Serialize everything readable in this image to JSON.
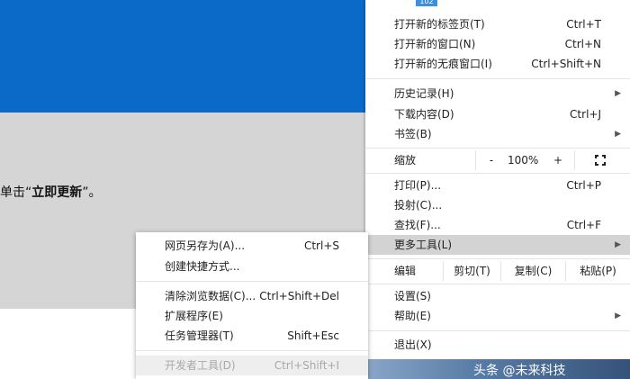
{
  "page": {
    "instruction_prefix": "单击“",
    "instruction_bold": "立即更新",
    "instruction_suffix": "”。"
  },
  "menu": {
    "badge": "102",
    "items": [
      {
        "label": "打开新的标签页(T)",
        "shortcut": "Ctrl+T"
      },
      {
        "label": "打开新的窗口(N)",
        "shortcut": "Ctrl+N"
      },
      {
        "label": "打开新的无痕窗口(I)",
        "shortcut": "Ctrl+Shift+N"
      },
      {
        "label": "历史记录(H)",
        "shortcut": "▶"
      },
      {
        "label": "下载内容(D)",
        "shortcut": "Ctrl+J"
      },
      {
        "label": "书签(B)",
        "shortcut": "▶"
      },
      {
        "label": "打印(P)...",
        "shortcut": "Ctrl+P"
      },
      {
        "label": "投射(C)...",
        "shortcut": ""
      },
      {
        "label": "查找(F)...",
        "shortcut": "Ctrl+F"
      },
      {
        "label": "更多工具(L)",
        "shortcut": "▶"
      },
      {
        "label": "设置(S)",
        "shortcut": ""
      },
      {
        "label": "帮助(E)",
        "shortcut": "▶"
      },
      {
        "label": "退出(X)",
        "shortcut": ""
      }
    ],
    "zoom": {
      "label": "缩放",
      "minus": "-",
      "value": "100%",
      "plus": "+"
    },
    "edit": {
      "label": "编辑",
      "cut": "剪切(T)",
      "copy": "复制(C)",
      "paste": "粘贴(P)"
    },
    "watermark": "头条 @未来科技"
  },
  "submenu": {
    "items": [
      {
        "label": "网页另存为(A)...",
        "shortcut": "Ctrl+S"
      },
      {
        "label": "创建快捷方式...",
        "shortcut": ""
      },
      {
        "label": "清除浏览数据(C)...",
        "shortcut": "Ctrl+Shift+Del"
      },
      {
        "label": "扩展程序(E)",
        "shortcut": ""
      },
      {
        "label": "任务管理器(T)",
        "shortcut": "Shift+Esc"
      },
      {
        "label": "开发者工具(D)",
        "shortcut": "Ctrl+Shift+I"
      }
    ]
  }
}
